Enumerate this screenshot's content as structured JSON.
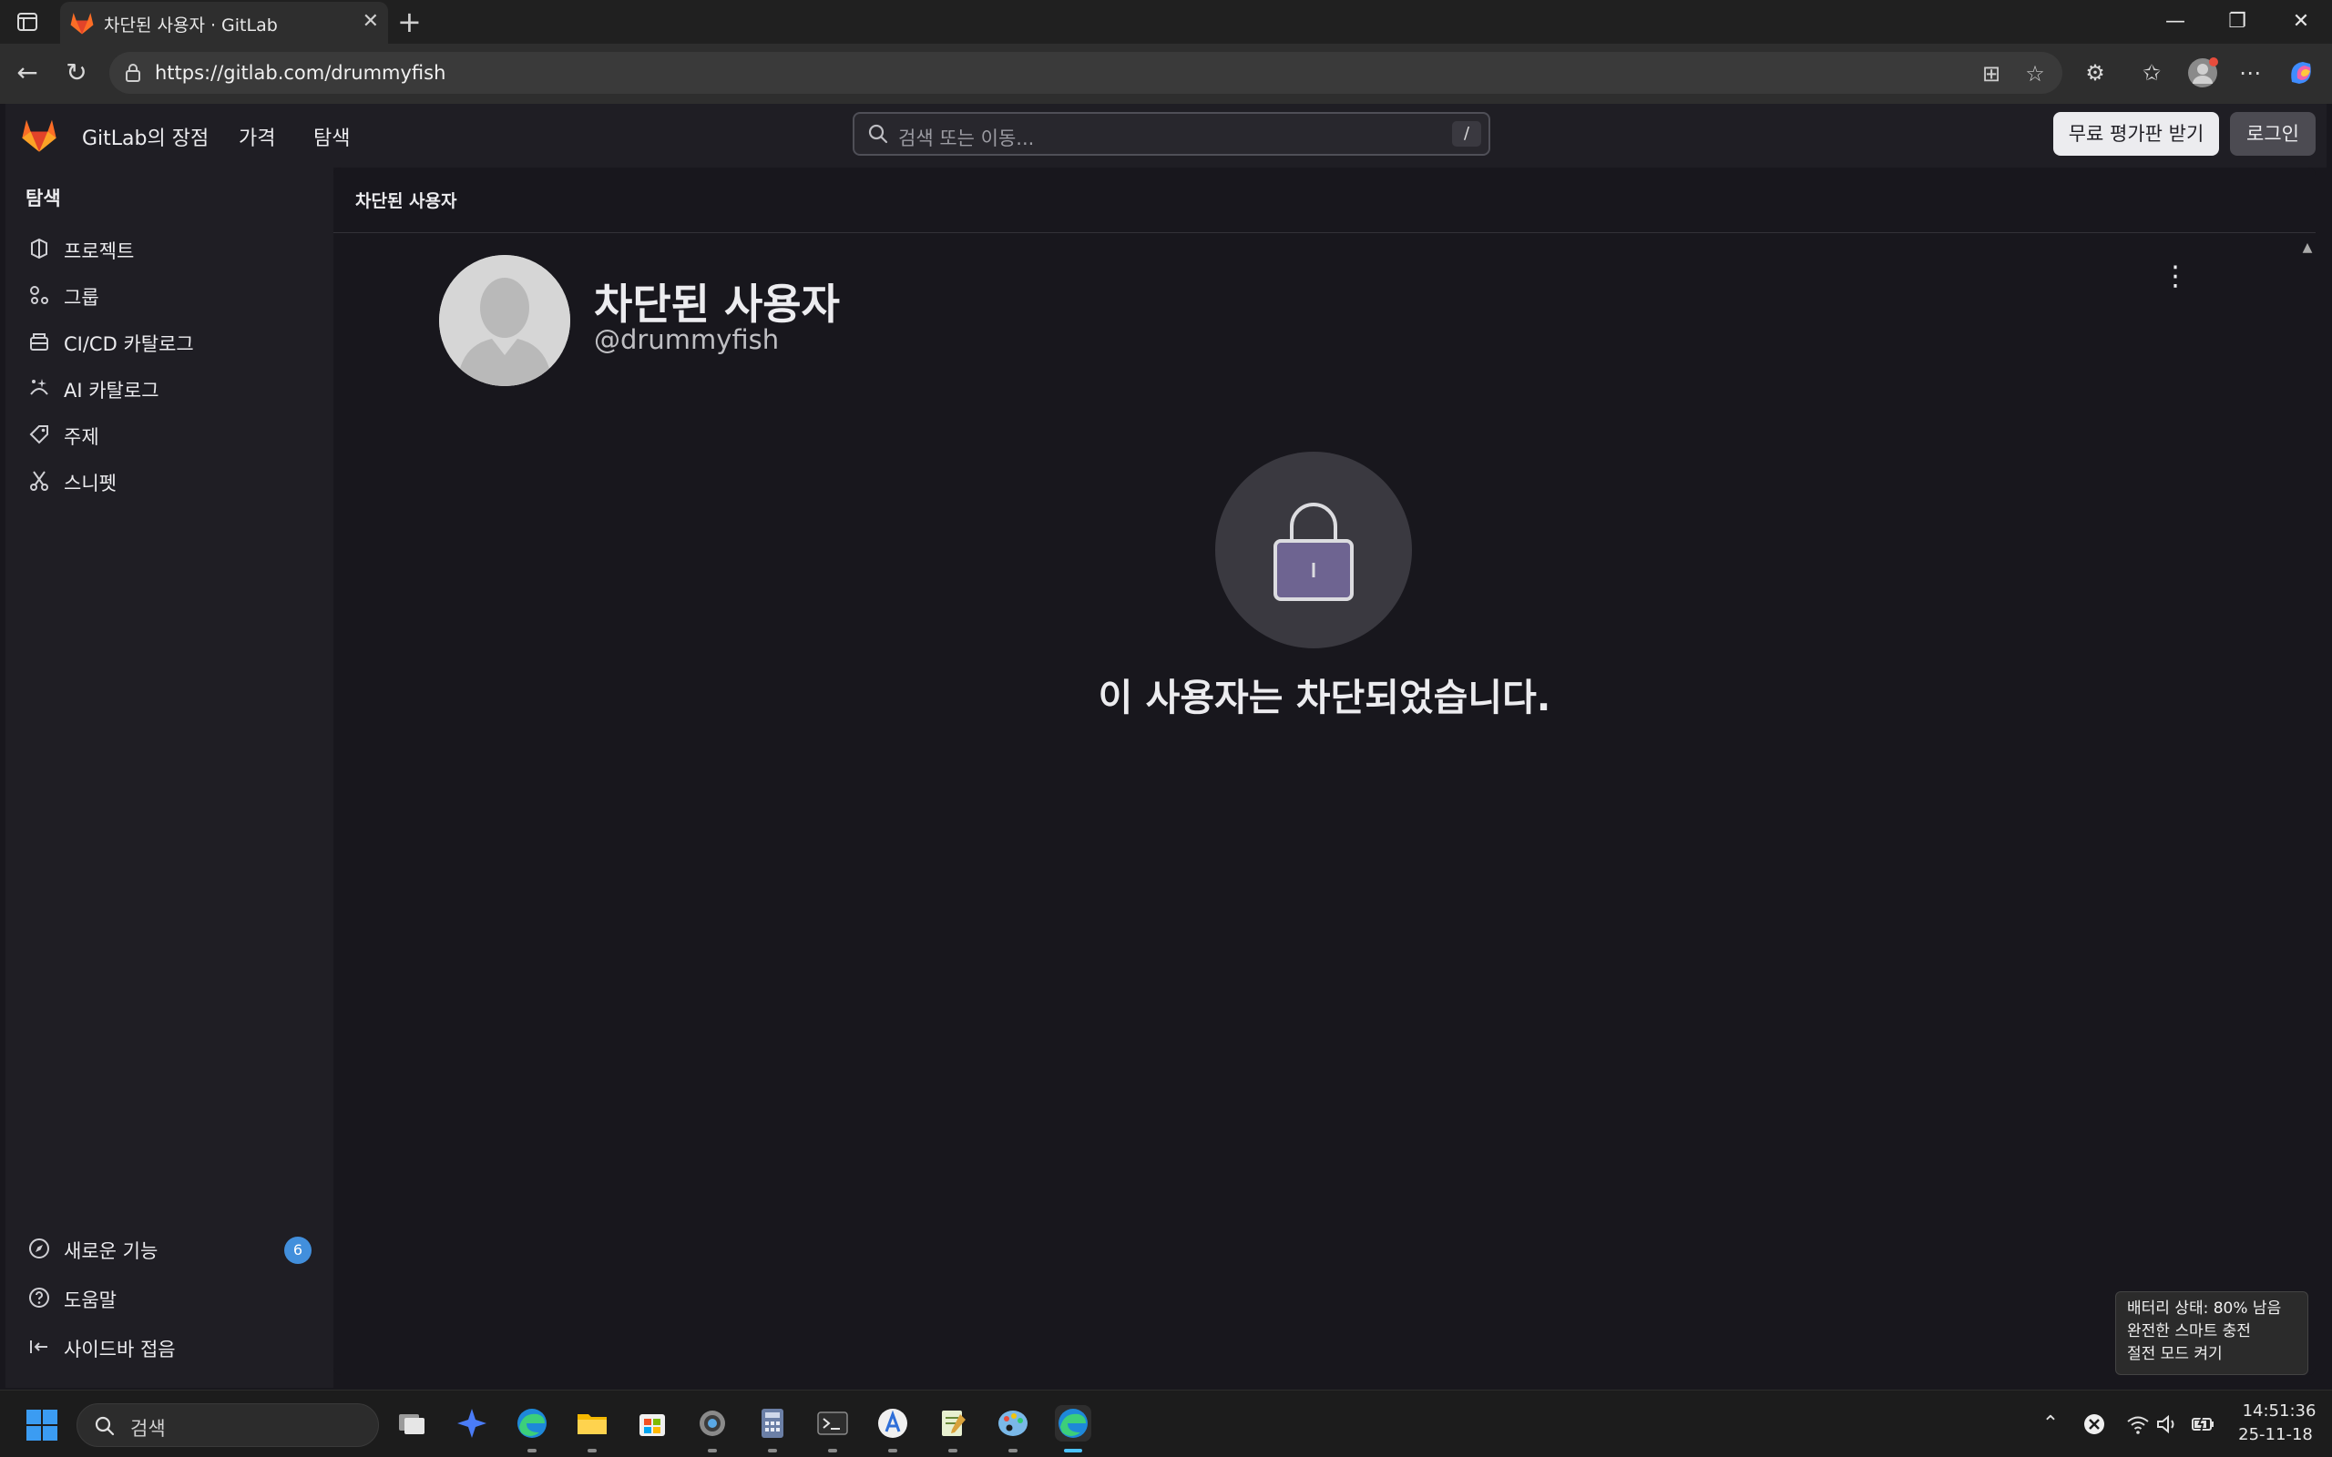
{
  "browser": {
    "tab_title": "차단된 사용자 · GitLab",
    "tab_close": "✕",
    "new_tab": "+",
    "url": "https://gitlab.com/drummyfish",
    "window_controls": {
      "minimize": "—",
      "restore": "❐",
      "close": "✕"
    }
  },
  "header": {
    "nav": [
      "GitLab의 장점",
      "가격",
      "탐색"
    ],
    "search_placeholder": "검색 또는 이동...",
    "search_shortcut": "/",
    "trial_button": "무료 평가판 받기",
    "signin_button": "로그인"
  },
  "sidebar": {
    "title": "탐색",
    "items": [
      {
        "label": "프로젝트",
        "icon": "project-icon"
      },
      {
        "label": "그룹",
        "icon": "group-icon"
      },
      {
        "label": "CI/CD 카탈로그",
        "icon": "catalog-icon"
      },
      {
        "label": "AI 카탈로그",
        "icon": "ai-icon"
      },
      {
        "label": "주제",
        "icon": "tag-icon"
      },
      {
        "label": "스니펫",
        "icon": "snippet-icon"
      }
    ],
    "footer": [
      {
        "label": "새로운 기능",
        "icon": "compass-icon",
        "badge": "6"
      },
      {
        "label": "도움말",
        "icon": "help-icon"
      },
      {
        "label": "사이드바 접음",
        "icon": "collapse-icon"
      }
    ]
  },
  "main": {
    "breadcrumb": "차단된 사용자",
    "profile_name": "차단된 사용자",
    "username": "@drummyfish",
    "blocked_message": "이 사용자는 차단되었습니다."
  },
  "tooltip": {
    "lines": [
      "배터리 상태: 80% 남음",
      "완전한 스마트 충전",
      "절전 모드 켜기"
    ]
  },
  "taskbar": {
    "search_placeholder": "검색",
    "time": "14:51:36",
    "date": "25-11-18"
  },
  "colors": {
    "gitlab_orange": "#fc6d26",
    "gitlab_red": "#e24329",
    "badge_blue": "#428fdc",
    "lock_purple": "#6e6491"
  }
}
